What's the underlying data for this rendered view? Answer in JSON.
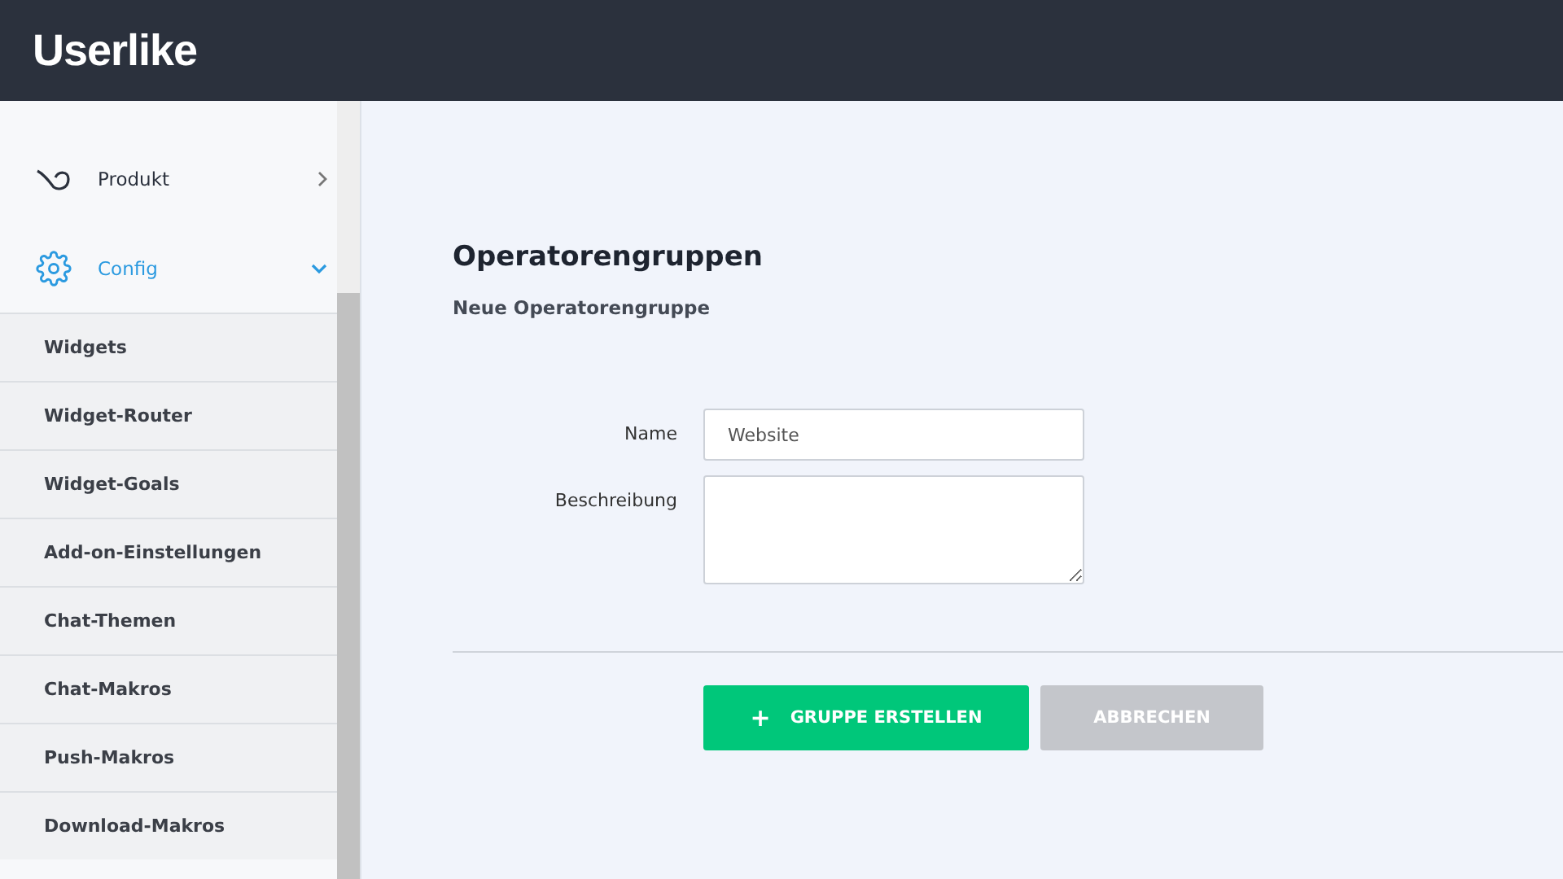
{
  "header": {
    "logo": "Userlike"
  },
  "sidebar": {
    "items": [
      {
        "label": "Produkt",
        "kind": "product",
        "expanded": false
      },
      {
        "label": "Config",
        "kind": "config",
        "expanded": true
      }
    ],
    "subitems": [
      "Widgets",
      "Widget-Router",
      "Widget-Goals",
      "Add-on-Einstellungen",
      "Chat-Themen",
      "Chat-Makros",
      "Push-Makros",
      "Download-Makros"
    ]
  },
  "main": {
    "title": "Operatorengruppen",
    "subtitle": "Neue Operatorengruppe",
    "fields": [
      {
        "label": "Name",
        "kind": "input",
        "value": "Website"
      },
      {
        "label": "Beschreibung",
        "kind": "textarea"
      }
    ],
    "buttons": [
      {
        "label": "GRUPPE ERSTELLEN",
        "icon": "+",
        "kind": "primary"
      },
      {
        "label": "ABBRECHEN",
        "kind": "secondary"
      }
    ]
  }
}
